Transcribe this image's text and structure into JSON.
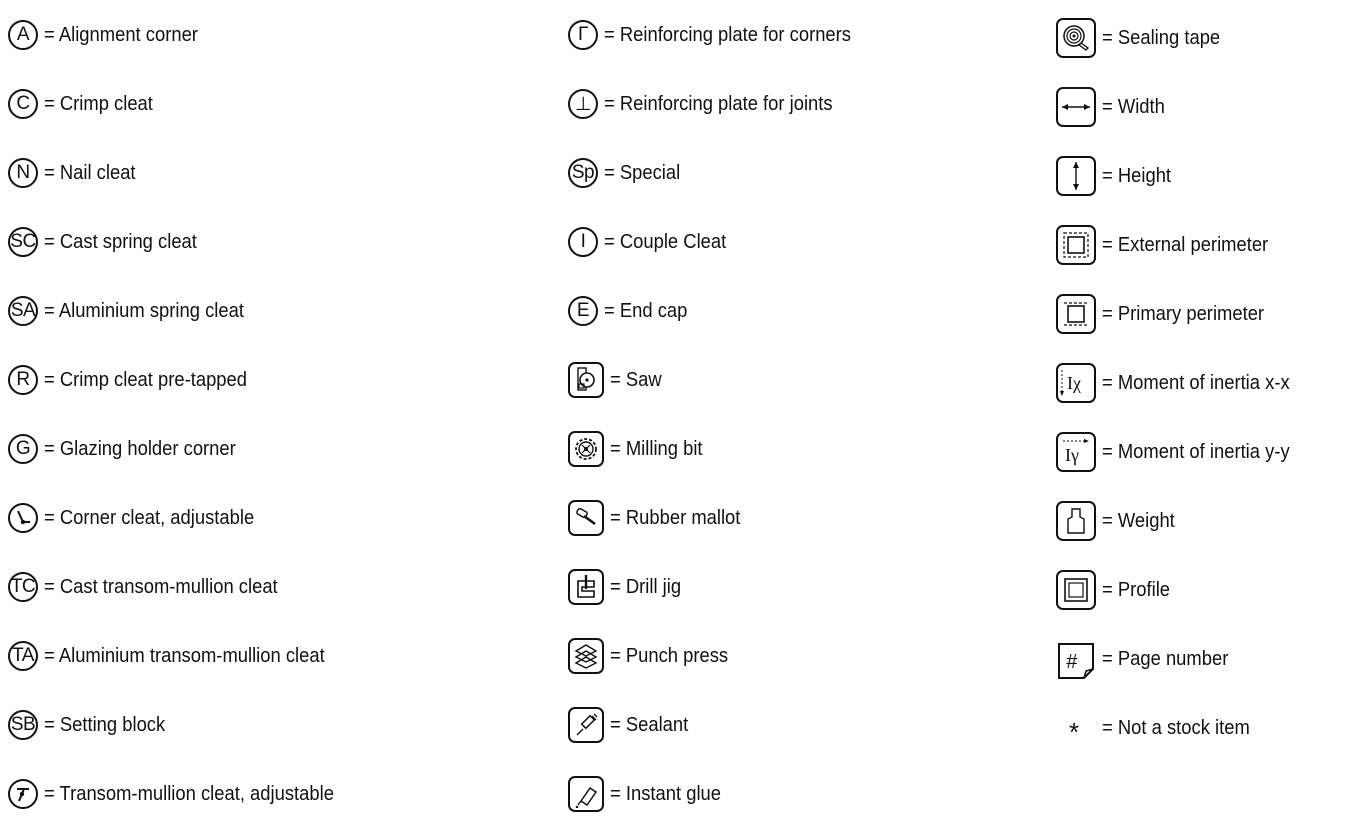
{
  "col1": [
    {
      "sym": "A",
      "label": "= Alignment corner"
    },
    {
      "sym": "C",
      "label": "= Crimp cleat"
    },
    {
      "sym": "N",
      "label": "= Nail cleat"
    },
    {
      "sym": "SC",
      "label": "= Cast spring cleat"
    },
    {
      "sym": "SA",
      "label": "= Aluminium spring cleat"
    },
    {
      "sym": "R",
      "label": "= Crimp cleat pre-tapped"
    },
    {
      "sym": "G",
      "label": "= Glazing holder corner"
    },
    {
      "sym": "",
      "label": "= Corner cleat, adjustable"
    },
    {
      "sym": "TC",
      "label": "= Cast transom-mullion cleat"
    },
    {
      "sym": "TA",
      "label": "= Aluminium transom-mullion cleat"
    },
    {
      "sym": "SB",
      "label": "= Setting block"
    },
    {
      "sym": "",
      "label": "= Transom-mullion cleat, adjustable"
    }
  ],
  "col2": [
    {
      "sym": "Γ",
      "label": "= Reinforcing plate for corners"
    },
    {
      "sym": "⊥",
      "label": "= Reinforcing plate for joints"
    },
    {
      "sym": "Sp",
      "label": "= Special"
    },
    {
      "sym": "I",
      "label": "= Couple Cleat"
    },
    {
      "sym": "E",
      "label": "= End cap"
    },
    {
      "sym": "",
      "label": "= Saw"
    },
    {
      "sym": "",
      "label": "= Milling bit"
    },
    {
      "sym": "",
      "label": "= Rubber mallot"
    },
    {
      "sym": "",
      "label": "= Drill jig"
    },
    {
      "sym": "",
      "label": "= Punch press"
    },
    {
      "sym": "",
      "label": "= Sealant"
    },
    {
      "sym": "",
      "label": "= Instant glue"
    }
  ],
  "col3": [
    {
      "label": "= Sealing tape"
    },
    {
      "label": "= Width"
    },
    {
      "label": "=  Height"
    },
    {
      "label": "= External perimeter"
    },
    {
      "label": "= Primary perimeter"
    },
    {
      "sym": "Ix",
      "label": "= Moment of inertia x-x"
    },
    {
      "sym": "Iy",
      "label": "= Moment of inertia y-y"
    },
    {
      "label": "= Weight"
    },
    {
      "label": "= Profile"
    },
    {
      "sym": "#",
      "label": "= Page number"
    },
    {
      "sym": "*",
      "label": "= Not a stock item"
    }
  ]
}
